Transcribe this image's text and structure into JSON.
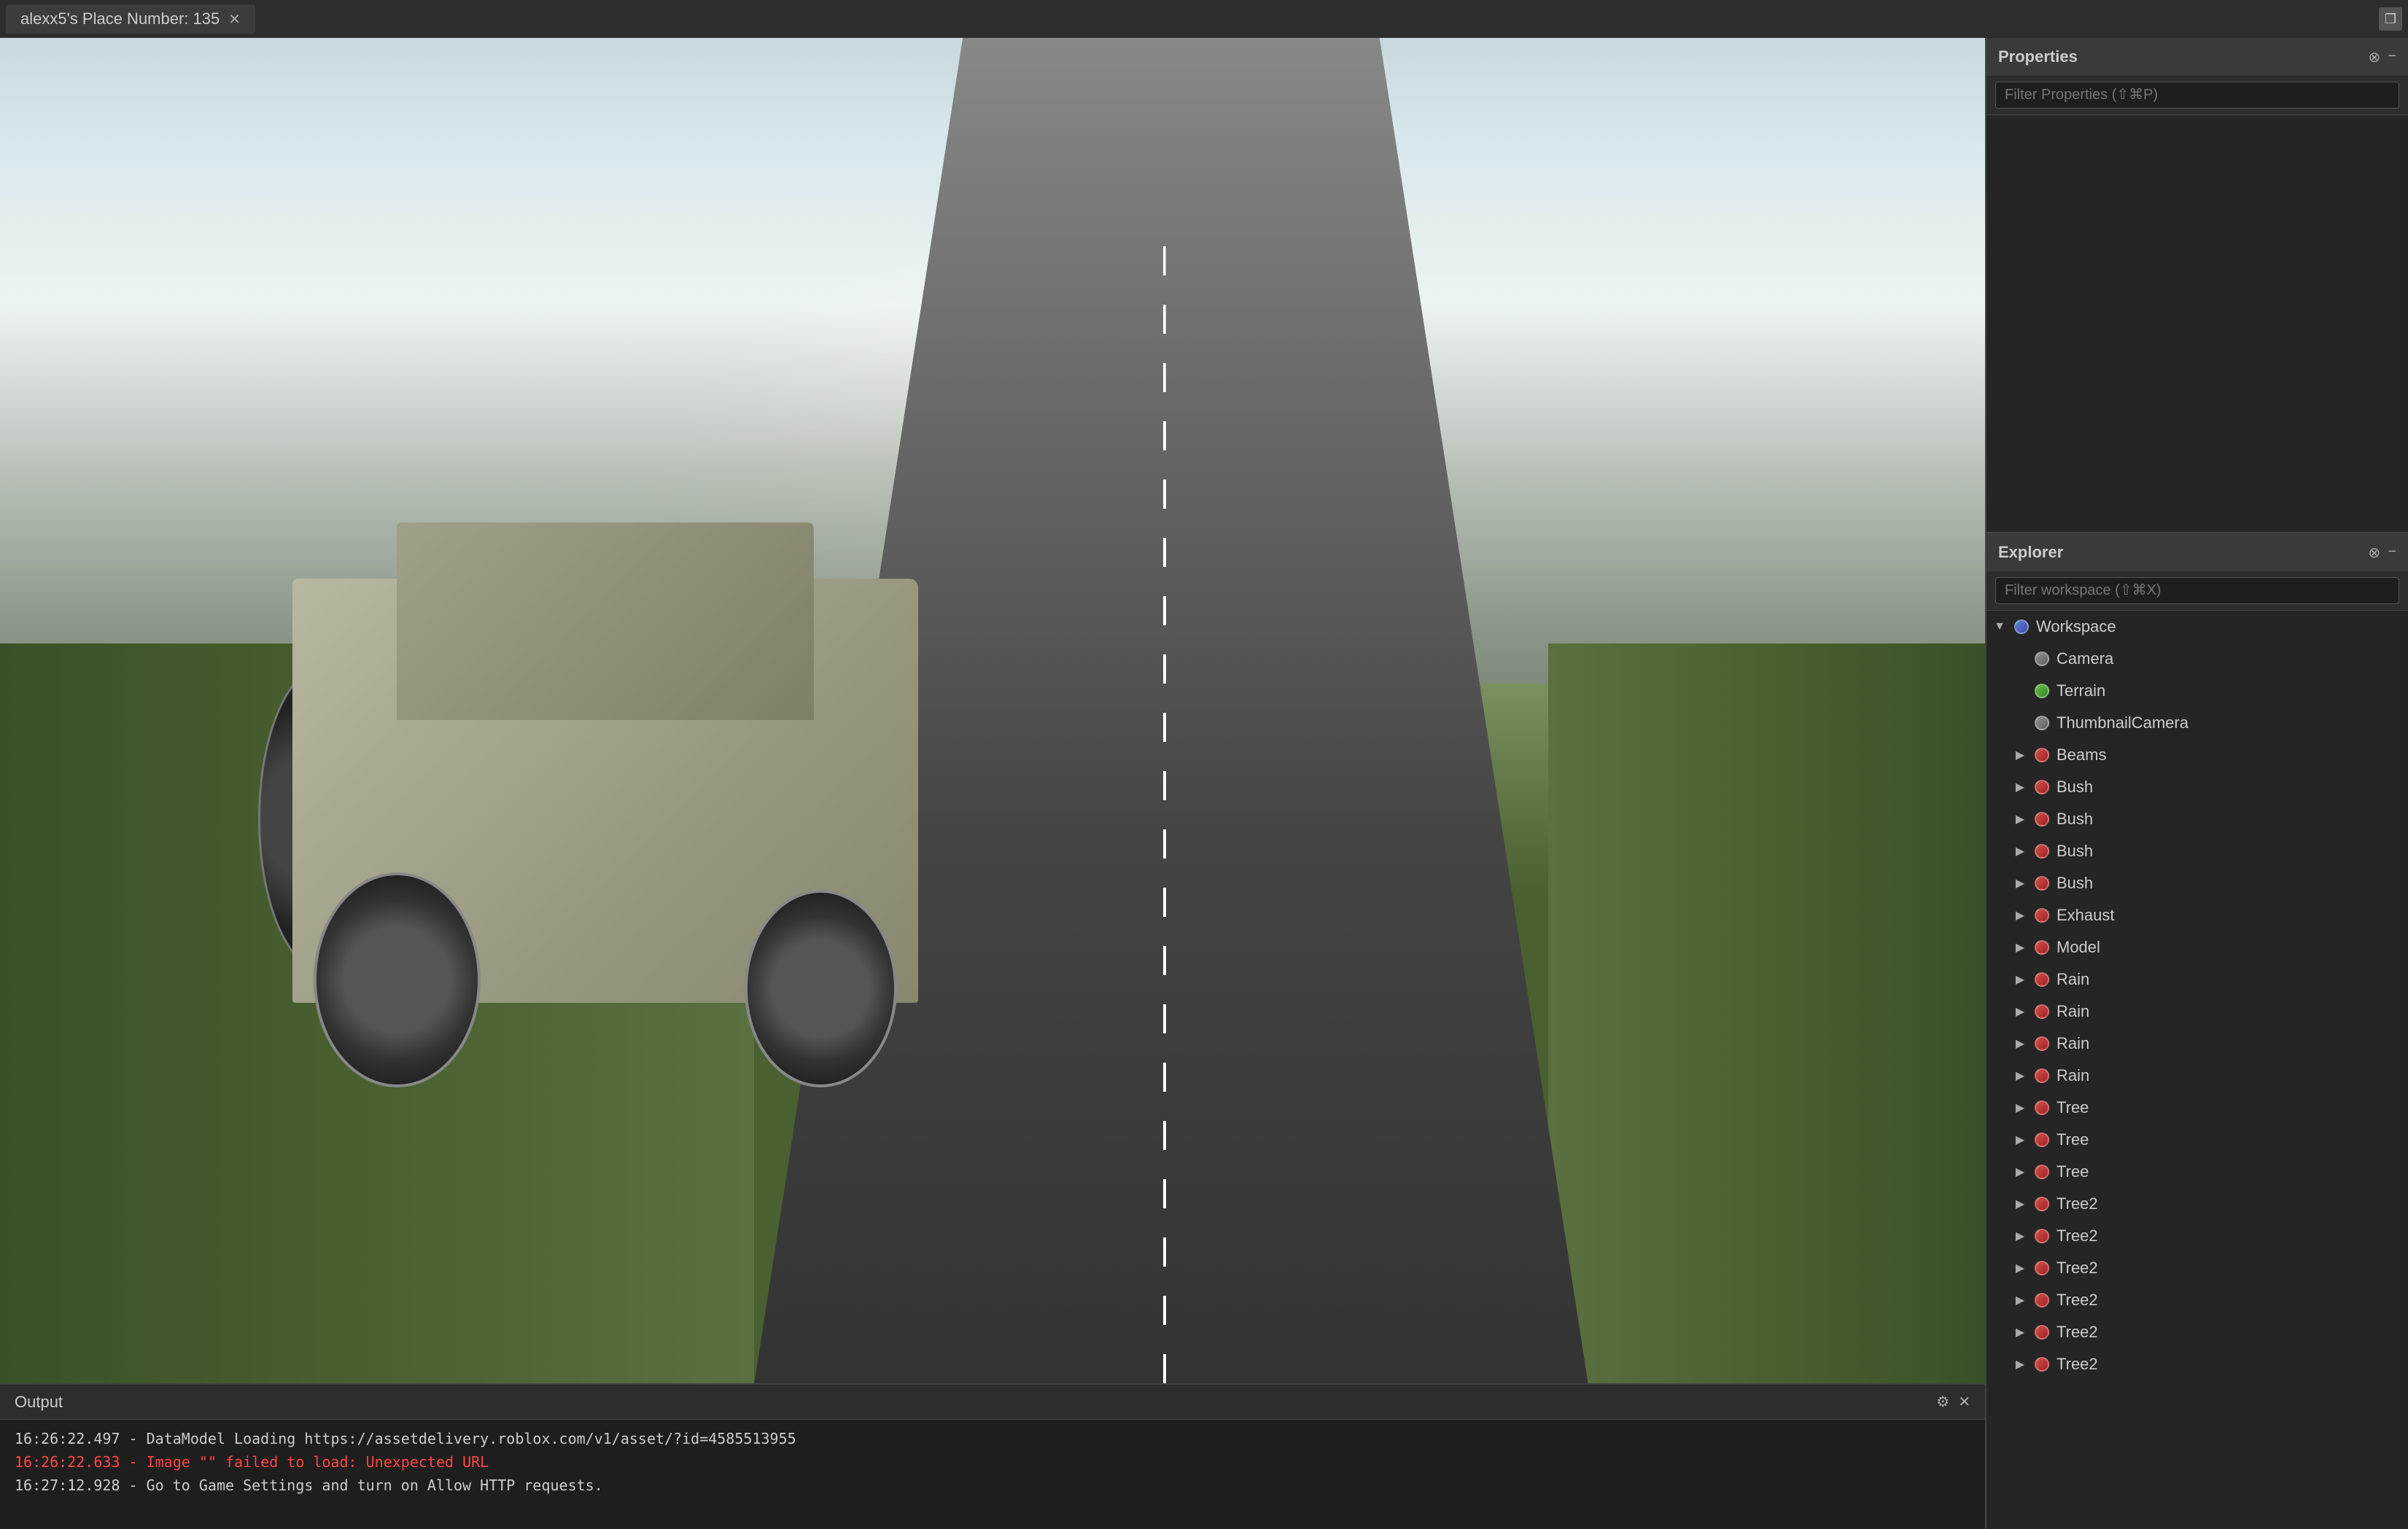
{
  "titlebar": {
    "tab_label": "alexx5's Place Number: 135",
    "close_symbol": "✕",
    "restore_symbol": "❐"
  },
  "properties_panel": {
    "title": "Properties",
    "close_symbol": "⊗",
    "minimize_symbol": "−",
    "filter_placeholder": "Filter Properties (⇧⌘P)"
  },
  "explorer_panel": {
    "title": "Explorer",
    "close_symbol": "⊗",
    "minimize_symbol": "−",
    "filter_placeholder": "Filter workspace (⇧⌘X)",
    "tree": [
      {
        "label": "Workspace",
        "level": 0,
        "expanded": true,
        "icon": "workspace",
        "id": "workspace"
      },
      {
        "label": "Camera",
        "level": 1,
        "expanded": false,
        "icon": "camera",
        "id": "camera"
      },
      {
        "label": "Terrain",
        "level": 1,
        "expanded": false,
        "icon": "terrain",
        "id": "terrain"
      },
      {
        "label": "ThumbnailCamera",
        "level": 1,
        "expanded": false,
        "icon": "thumbnail",
        "id": "thumbnailcamera"
      },
      {
        "label": "Beams",
        "level": 1,
        "expanded": false,
        "icon": "beams",
        "id": "beams"
      },
      {
        "label": "Bush",
        "level": 1,
        "expanded": false,
        "icon": "bush",
        "id": "bush1"
      },
      {
        "label": "Bush",
        "level": 1,
        "expanded": false,
        "icon": "bush",
        "id": "bush2"
      },
      {
        "label": "Bush",
        "level": 1,
        "expanded": false,
        "icon": "bush",
        "id": "bush3"
      },
      {
        "label": "Bush",
        "level": 1,
        "expanded": false,
        "icon": "bush",
        "id": "bush4"
      },
      {
        "label": "Exhaust",
        "level": 1,
        "expanded": false,
        "icon": "exhaust",
        "id": "exhaust"
      },
      {
        "label": "Model",
        "level": 1,
        "expanded": false,
        "icon": "model",
        "id": "model"
      },
      {
        "label": "Rain",
        "level": 1,
        "expanded": false,
        "icon": "rain",
        "id": "rain1"
      },
      {
        "label": "Rain",
        "level": 1,
        "expanded": false,
        "icon": "rain",
        "id": "rain2"
      },
      {
        "label": "Rain",
        "level": 1,
        "expanded": false,
        "icon": "rain",
        "id": "rain3"
      },
      {
        "label": "Rain",
        "level": 1,
        "expanded": false,
        "icon": "rain",
        "id": "rain4"
      },
      {
        "label": "Tree",
        "level": 1,
        "expanded": false,
        "icon": "tree",
        "id": "tree1"
      },
      {
        "label": "Tree",
        "level": 1,
        "expanded": false,
        "icon": "tree",
        "id": "tree2"
      },
      {
        "label": "Tree",
        "level": 1,
        "expanded": false,
        "icon": "tree",
        "id": "tree3"
      },
      {
        "label": "Tree2",
        "level": 1,
        "expanded": false,
        "icon": "tree",
        "id": "tree2a"
      },
      {
        "label": "Tree2",
        "level": 1,
        "expanded": false,
        "icon": "tree",
        "id": "tree2b"
      },
      {
        "label": "Tree2",
        "level": 1,
        "expanded": false,
        "icon": "tree",
        "id": "tree2c"
      },
      {
        "label": "Tree2",
        "level": 1,
        "expanded": false,
        "icon": "tree",
        "id": "tree2d"
      },
      {
        "label": "Tree2",
        "level": 1,
        "expanded": false,
        "icon": "tree",
        "id": "tree2e"
      },
      {
        "label": "Tree2",
        "level": 1,
        "expanded": false,
        "icon": "tree",
        "id": "tree2f"
      }
    ]
  },
  "output_panel": {
    "title": "Output",
    "close_symbol": "✕",
    "settings_symbol": "⚙",
    "logs": [
      {
        "text": "16:26:22.497 - DataModel Loading https://assetdelivery.roblox.com/v1/asset/?id=4585513955",
        "type": "normal"
      },
      {
        "text": "16:26:22.633 - Image \"\" failed to load: Unexpected URL",
        "type": "error"
      },
      {
        "text": "16:27:12.928 - Go to Game Settings and turn on Allow HTTP requests.",
        "type": "normal"
      }
    ]
  },
  "colors": {
    "accent": "#4080c0",
    "error_text": "#ff4444",
    "normal_text": "#cccccc",
    "panel_bg": "#2d2d2d",
    "item_bg": "#252525"
  }
}
